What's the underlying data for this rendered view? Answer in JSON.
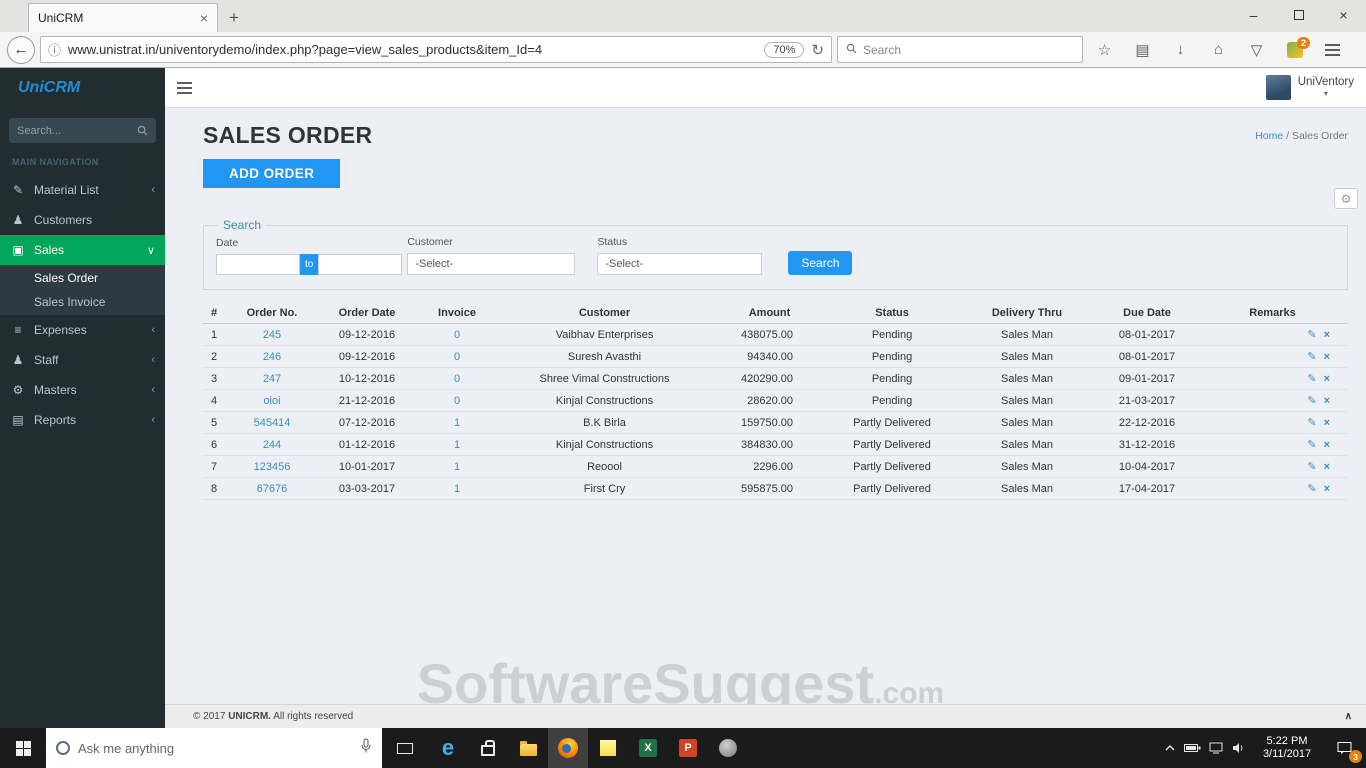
{
  "colors": {
    "accent_blue": "#2196f3",
    "link_blue": "#3c8dbc",
    "active_green": "#00a65a",
    "sidebar_bg": "#222d32",
    "content_bg": "#ecf0f5",
    "badge_orange": "#e8820c"
  },
  "browser": {
    "tab_title": "UniCRM",
    "url": "www.unistrat.in/univentorydemo/index.php?page=view_sales_products&item_Id=4",
    "zoom_level": "70%",
    "search_placeholder": "Search",
    "extension_badge": "2"
  },
  "app": {
    "logo_text": "UniCRM",
    "user_name": "UniVentory",
    "sidebar": {
      "search_placeholder": "Search...",
      "nav_label": "MAIN NAVIGATION",
      "items": [
        {
          "label": "Material List"
        },
        {
          "label": "Customers"
        },
        {
          "label": "Sales"
        },
        {
          "label": "Expenses"
        },
        {
          "label": "Staff"
        },
        {
          "label": "Masters"
        },
        {
          "label": "Reports"
        }
      ],
      "sales_submenu": [
        {
          "label": "Sales Order"
        },
        {
          "label": "Sales Invoice"
        }
      ]
    },
    "page": {
      "title": "SALES ORDER",
      "breadcrumb": {
        "home": "Home",
        "separator": "/",
        "current": "Sales Order"
      },
      "add_order_button": "ADD ORDER",
      "search_panel": {
        "legend": "Search",
        "date_label": "Date",
        "to_label": "to",
        "customer_label": "Customer",
        "customer_value": "-Select-",
        "status_label": "Status",
        "status_value": "-Select-",
        "search_button": "Search"
      },
      "table": {
        "headers": [
          "#",
          "Order No.",
          "Order Date",
          "Invoice",
          "Customer",
          "Amount",
          "Status",
          "Delivery Thru",
          "Due Date",
          "Remarks"
        ],
        "rows": [
          [
            "1",
            "245",
            "09-12-2016",
            "0",
            "Vaibhav Enterprises",
            "438075.00",
            "Pending",
            "Sales Man",
            "08-01-2017"
          ],
          [
            "2",
            "246",
            "09-12-2016",
            "0",
            "Suresh Avasthi",
            "94340.00",
            "Pending",
            "Sales Man",
            "08-01-2017"
          ],
          [
            "3",
            "247",
            "10-12-2016",
            "0",
            "Shree Vimal Constructions",
            "420290.00",
            "Pending",
            "Sales Man",
            "09-01-2017"
          ],
          [
            "4",
            "oioi",
            "21-12-2016",
            "0",
            "Kinjal Constructions",
            "28620.00",
            "Pending",
            "Sales Man",
            "21-03-2017"
          ],
          [
            "5",
            "545414",
            "07-12-2016",
            "1",
            "B.K Birla",
            "159750.00",
            "Partly Delivered",
            "Sales Man",
            "22-12-2016"
          ],
          [
            "6",
            "244",
            "01-12-2016",
            "1",
            "Kinjal Constructions",
            "384830.00",
            "Partly Delivered",
            "Sales Man",
            "31-12-2016"
          ],
          [
            "7",
            "123456",
            "10-01-2017",
            "1",
            "Reoool",
            "2296.00",
            "Partly Delivered",
            "Sales Man",
            "10-04-2017"
          ],
          [
            "8",
            "67676",
            "03-03-2017",
            "1",
            "First Cry",
            "595875.00",
            "Partly Delivered",
            "Sales Man",
            "17-04-2017"
          ]
        ]
      },
      "watermark": {
        "main": "SoftwareSuggest",
        "suffix": ".com"
      },
      "footer": {
        "prefix": "© 2017",
        "brand": "UNICRM.",
        "suffix": "All rights reserved"
      }
    }
  },
  "taskbar": {
    "search_placeholder": "Ask me anything",
    "clock": {
      "time": "5:22 PM",
      "date": "3/11/2017"
    },
    "notification_badge": "3"
  }
}
